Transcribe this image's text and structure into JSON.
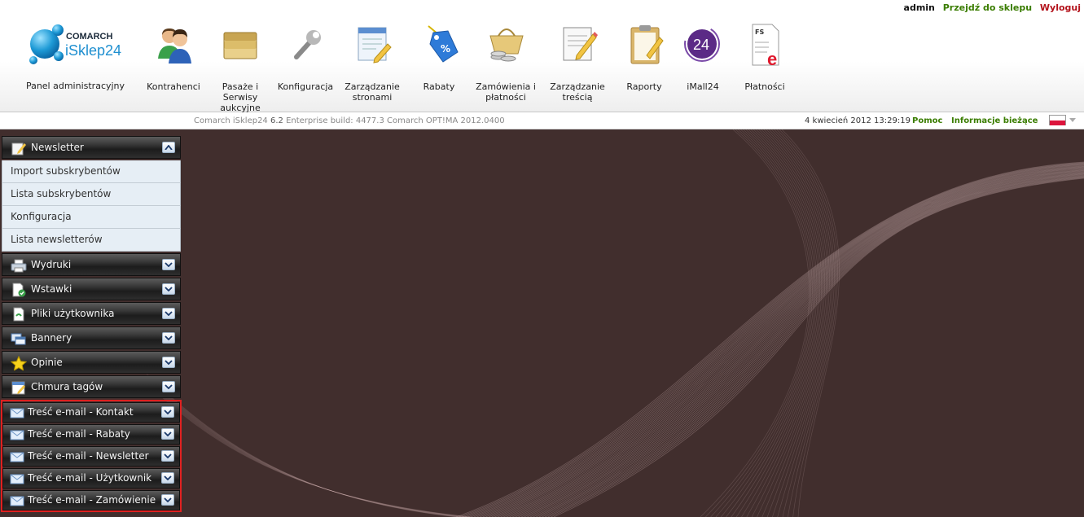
{
  "user": {
    "name": "admin",
    "shop_link": "Przejdź do sklepu",
    "logout_link": "Wyloguj"
  },
  "logo": {
    "brand_top": "COMARCH",
    "brand_bottom": "iSklep24",
    "label": "Panel administracyjny"
  },
  "toolbar": [
    {
      "label": "Kontrahenci",
      "icon": "contractors-icon"
    },
    {
      "label": "Pasaże i Serwisy aukcyjne",
      "icon": "folders-icon"
    },
    {
      "label": "Konfiguracja",
      "icon": "wrench-icon"
    },
    {
      "label": "Zarządzanie stronami",
      "icon": "page-edit-icon"
    },
    {
      "label": "Rabaty",
      "icon": "discount-tag-icon"
    },
    {
      "label": "Zamówienia i płatności",
      "icon": "basket-coins-icon"
    },
    {
      "label": "Zarządzanie treścią",
      "icon": "content-edit-icon"
    },
    {
      "label": "Raporty",
      "icon": "clipboard-icon"
    },
    {
      "label": "iMall24",
      "icon": "imall-24-icon",
      "badge": "24"
    },
    {
      "label": "Płatności",
      "icon": "fs-e-document-icon",
      "badge": "FS"
    }
  ],
  "status": {
    "version_product": "Comarch iSklep24",
    "version_number": "6.2",
    "version_rest": "Enterprise build: 4477.3  Comarch OPT!MA 2012.0400",
    "datetime": "4 kwiecień 2012 13:29:19",
    "help": "Pomoc",
    "info": "Informacje bieżące",
    "language_flag": "pl-flag-icon"
  },
  "sidebar": {
    "newsletter": {
      "title": "Newsletter",
      "items": [
        "Import subskrybentów",
        "Lista subskrybentów",
        "Konfiguracja",
        "Lista newsletterów"
      ]
    },
    "sections": [
      {
        "title": "Wydruki",
        "icon": "printer-icon"
      },
      {
        "title": "Wstawki",
        "icon": "document-check-icon"
      },
      {
        "title": "Pliki użytkownika",
        "icon": "user-files-icon"
      },
      {
        "title": "Bannery",
        "icon": "banners-icon"
      },
      {
        "title": "Opinie",
        "icon": "star-icon"
      },
      {
        "title": "Chmura tagów",
        "icon": "tag-cloud-icon"
      }
    ],
    "email_sections": [
      {
        "title": "Treść e-mail - Kontakt"
      },
      {
        "title": "Treść e-mail - Rabaty"
      },
      {
        "title": "Treść e-mail - Newsletter"
      },
      {
        "title": "Treść e-mail - Użytkownik"
      },
      {
        "title": "Treść e-mail - Zamówienie"
      }
    ]
  },
  "colors": {
    "main_bg": "#412e2d",
    "accent_green": "#3a7d00",
    "logout_red": "#b3121b",
    "highlight_border": "#e02020"
  }
}
